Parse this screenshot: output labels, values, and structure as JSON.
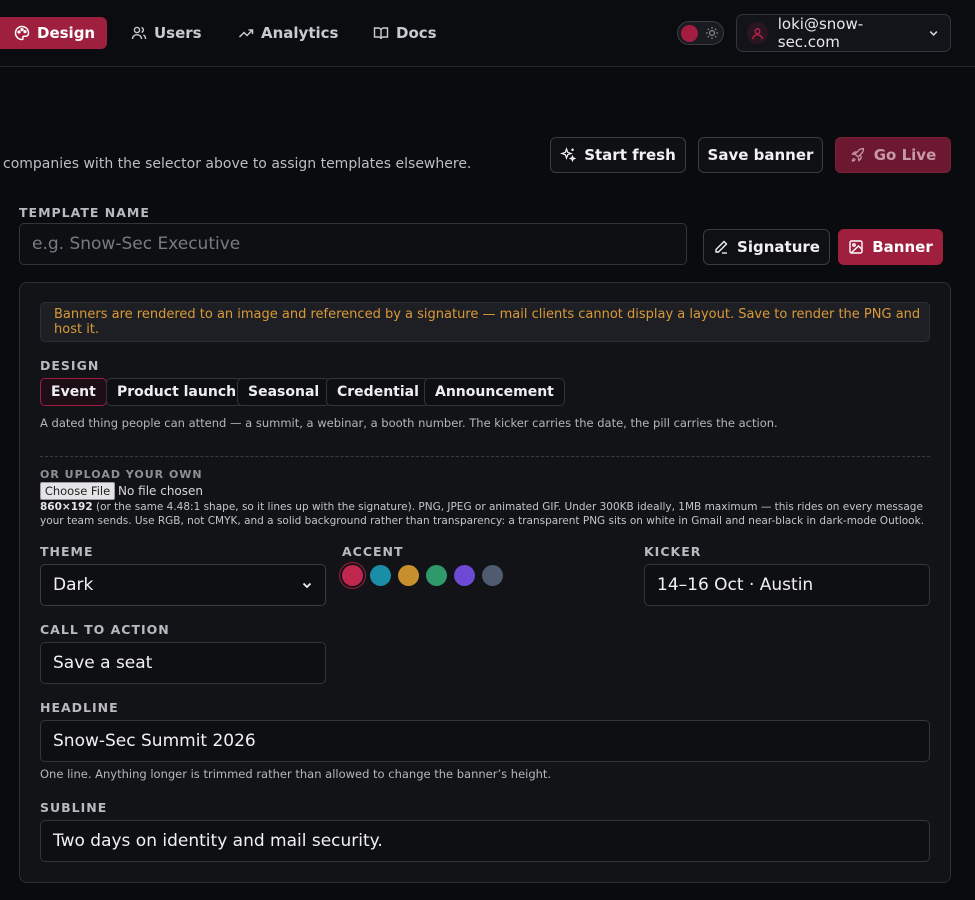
{
  "nav": {
    "items": [
      {
        "label": "Design",
        "icon": "palette-icon"
      },
      {
        "label": "Users",
        "icon": "users-icon"
      },
      {
        "label": "Analytics",
        "icon": "trending-up-icon"
      },
      {
        "label": "Docs",
        "icon": "book-icon"
      }
    ],
    "account": "loki@snow-sec.com"
  },
  "colors": {
    "accent": "#9f1f3f",
    "warning": "#d99a36"
  },
  "header": {
    "hint": "companies with the selector above to assign templates elsewhere.",
    "start_fresh": "Start fresh",
    "save_banner": "Save banner",
    "go_live": "Go Live"
  },
  "template": {
    "label": "TEMPLATE NAME",
    "placeholder": "e.g. Snow-Sec Executive",
    "signature_label": "Signature",
    "banner_label": "Banner"
  },
  "notice": "Banners are rendered to an image and referenced by a signature — mail clients cannot display a layout. Save to render the PNG and host it.",
  "design": {
    "label": "DESIGN",
    "options": [
      "Event",
      "Product launch",
      "Seasonal",
      "Credential",
      "Announcement"
    ],
    "selected": "Event",
    "description": "A dated thing people can attend — a summit, a webinar, a booth number. The kicker carries the date, the pill carries the action."
  },
  "upload": {
    "label": "OR UPLOAD YOUR OWN",
    "button": "Choose File",
    "status": "No file chosen",
    "size": "860×192",
    "help": " (or the same 4.48:1 shape, so it lines up with the signature). PNG, JPEG or animated GIF. Under 300KB ideally, 1MB maximum — this rides on every message your team sends. Use RGB, not CMYK, and a solid background rather than transparency: a transparent PNG sits on white in Gmail and near-black in dark-mode Outlook."
  },
  "theme": {
    "label": "THEME",
    "value": "Dark"
  },
  "accent": {
    "label": "ACCENT",
    "swatches": [
      "#c0264e",
      "#1a8ea6",
      "#c8902c",
      "#2e9a6a",
      "#6c4ad6",
      "#4f5b6e"
    ],
    "selected": 0
  },
  "kicker": {
    "label": "KICKER",
    "value": "14–16 Oct · Austin"
  },
  "cta": {
    "label": "CALL TO ACTION",
    "value": "Save a seat"
  },
  "headline": {
    "label": "HEADLINE",
    "value": "Snow-Sec Summit 2026",
    "help": "One line. Anything longer is trimmed rather than allowed to change the banner’s height."
  },
  "subline": {
    "label": "SUBLINE",
    "value": "Two days on identity and mail security."
  }
}
